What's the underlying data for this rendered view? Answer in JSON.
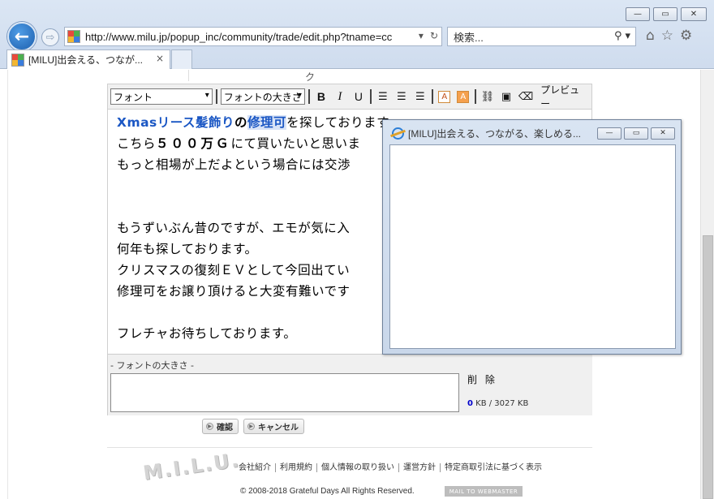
{
  "browser": {
    "address_main": "http://www.milu.jp/popup_inc/community/trade/edit.php?tname=cc",
    "search_placeholder": "検索...",
    "tab_title": "[MILU]出会える、つなが...",
    "tab_close": "×",
    "window_controls": {
      "minimize": "—",
      "maximize": "▭",
      "close": "✕"
    },
    "icons": [
      "back-arrow-icon",
      "forward-arrow-icon",
      "home-icon",
      "star-icon",
      "gear-icon",
      "search-icon",
      "refresh-icon"
    ]
  },
  "page": {
    "strip": {
      "cell3": "ク"
    },
    "toolbar": {
      "font_select": "フォント",
      "size_select": "フォントの大きさ",
      "bold": "B",
      "italic": "I",
      "underline": "U",
      "text_color": "A",
      "bg_color": "A",
      "preview": "プレビュー"
    },
    "content": {
      "line1_blue1": "Xmasリース髪飾り",
      "line1_mid": "の",
      "line1_blue2": "修理可",
      "line1_end": "を探しております。",
      "line2_a": "こちら",
      "line2_b": "５００万Ｇ",
      "line2_c": "にて買いたいと思いま",
      "line3": "もっと相場が上だよという場合には交渉",
      "line4": "もうずいぶん昔のですが、エモが気に入",
      "line5": "何年も探しております。",
      "line6": "クリスマスの復刻ＥＶとして今回出てい",
      "line7": "修理可をお譲り頂けると大変有難いです",
      "line8": "フレチャお待ちしております。"
    },
    "lower": {
      "label": "- フォントの大きさ -",
      "delete": "削 除",
      "kb_used": "0",
      "kb_rest": " KB / 3027 KB"
    },
    "actions": {
      "confirm": "確認",
      "cancel": "キャンセル"
    },
    "footer": {
      "logo": "M.I.L.U.",
      "links": [
        "会社紹介",
        "利用規約",
        "個人情報の取り扱い",
        "運営方針",
        "特定商取引法に基づく表示"
      ],
      "copyright": "© 2008-2018 Grateful Days All Rights Reserved.",
      "mail": "MAIL TO WEBMASTER"
    }
  },
  "popup": {
    "title": "[MILU]出会える、つながる、楽しめる...",
    "controls": {
      "minimize": "—",
      "maximize": "▭",
      "close": "✕"
    }
  },
  "colors": {
    "accent_blue": "#1b57c4",
    "chrome_bg": "#d3dfef",
    "color_button": "#f5a04d"
  }
}
